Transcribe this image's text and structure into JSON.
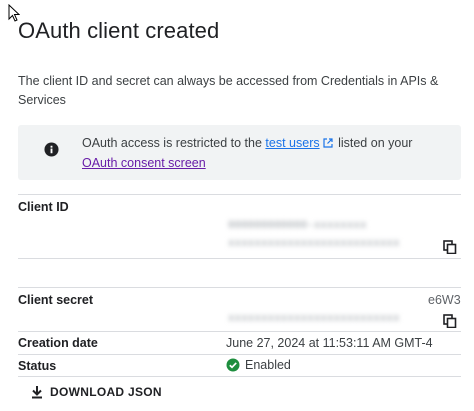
{
  "dialog": {
    "title": "OAuth client created",
    "description": "The client ID and secret can always be accessed from Credentials in APIs & Services"
  },
  "notice": {
    "icon": "info-icon",
    "text_before": "OAuth access is restricted to the ",
    "test_users_link": "test users",
    "text_after": " listed on your ",
    "consent_link": "OAuth consent screen"
  },
  "fields": {
    "client_id": {
      "label": "Client ID",
      "icon": "copy-icon"
    },
    "client_secret": {
      "label": "Client secret",
      "visible_suffix": "e6W3",
      "icon": "copy-icon"
    },
    "creation_date": {
      "label": "Creation date",
      "value": "June 27, 2024 at 11:53:11 AM GMT-4"
    },
    "status": {
      "label": "Status",
      "value": "Enabled",
      "icon": "check-circle-icon",
      "color": "#1e8e3e"
    }
  },
  "actions": {
    "download_label": "DOWNLOAD JSON",
    "download_icon": "download-icon"
  },
  "colors": {
    "link": "#1a73e8",
    "visited_link": "#681da8",
    "notice_bg": "#f1f3f4"
  }
}
